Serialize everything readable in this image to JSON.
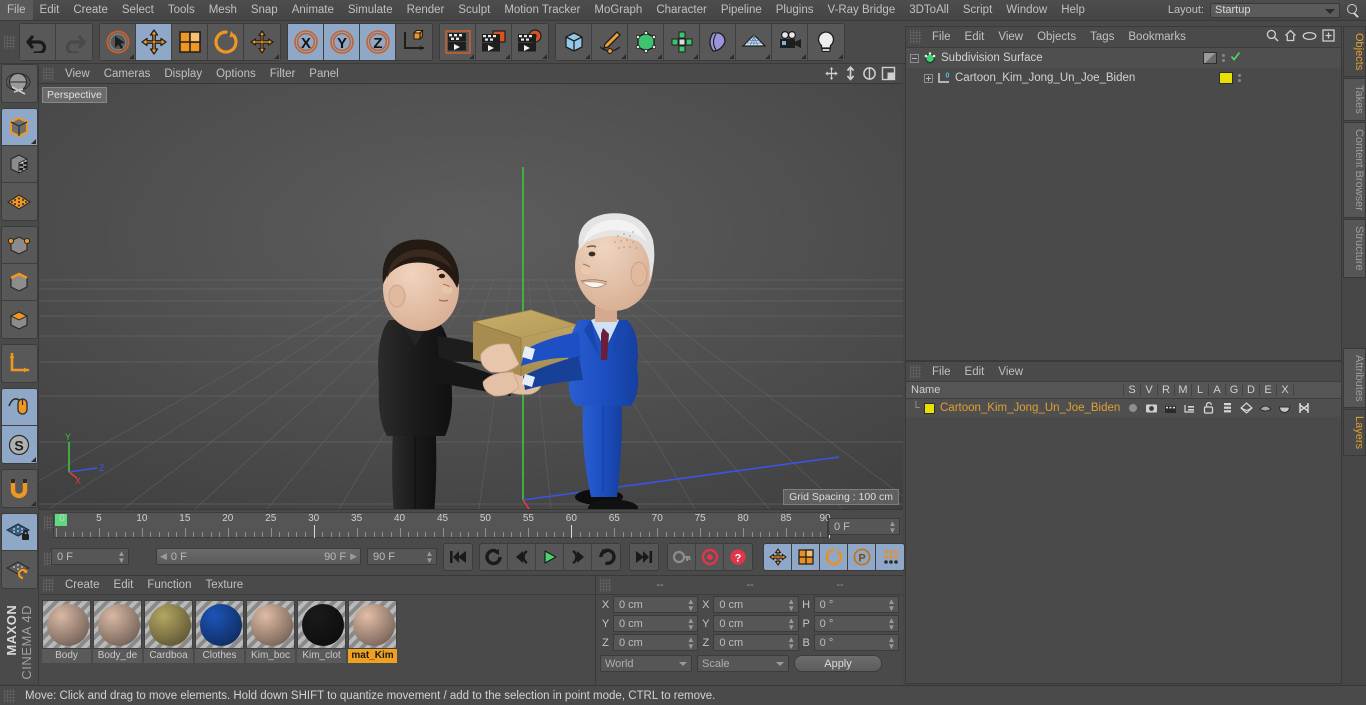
{
  "menubar": {
    "items": [
      "File",
      "Edit",
      "Create",
      "Select",
      "Tools",
      "Mesh",
      "Snap",
      "Animate",
      "Simulate",
      "Render",
      "Sculpt",
      "Motion Tracker",
      "MoGraph",
      "Character",
      "Pipeline",
      "Plugins",
      "V-Ray Bridge",
      "3DToAll",
      "Script",
      "Window",
      "Help"
    ],
    "layout_label": "Layout:",
    "layout_value": "Startup",
    "search_icon": "search-icon"
  },
  "toolbar": {
    "undo": "undo-arrow-icon",
    "redo": "redo-arrow-icon",
    "groups": [
      {
        "name": "selection-tools",
        "buttons": [
          {
            "icon": "live-selection-icon",
            "label": "Live Selection",
            "active": false
          },
          {
            "icon": "move-icon",
            "label": "Move",
            "active": true
          },
          {
            "icon": "scale-icon",
            "label": "Scale",
            "active": false
          },
          {
            "icon": "rotate-icon",
            "label": "Rotate",
            "active": false
          },
          {
            "icon": "move-alt-icon",
            "label": "Move Tool",
            "active": false
          }
        ]
      },
      {
        "name": "axis-locks",
        "buttons": [
          {
            "icon": "x-axis-icon",
            "label": "X",
            "active": true
          },
          {
            "icon": "y-axis-icon",
            "label": "Y",
            "active": true
          },
          {
            "icon": "z-axis-icon",
            "label": "Z",
            "active": true
          },
          {
            "icon": "world-object-axis-icon",
            "label": "World/Object",
            "active": false
          }
        ]
      },
      {
        "name": "render-tools",
        "buttons": [
          {
            "icon": "render-view-icon",
            "label": "Render View",
            "active": false
          },
          {
            "icon": "render-region-icon",
            "label": "Render to Picture Viewer",
            "active": false
          },
          {
            "icon": "render-settings-icon",
            "label": "Edit Render Settings",
            "active": false
          }
        ]
      },
      {
        "name": "object-creation",
        "buttons": [
          {
            "icon": "cube-primitive-icon",
            "label": "Cube",
            "active": false
          },
          {
            "icon": "spline-pen-icon",
            "label": "Pen",
            "active": false
          },
          {
            "icon": "nurbs-icon",
            "label": "Subdivision Surface",
            "active": false
          },
          {
            "icon": "array-icon",
            "label": "Array",
            "active": false
          },
          {
            "icon": "deformer-icon",
            "label": "Bend",
            "active": false
          },
          {
            "icon": "floor-environment-icon",
            "label": "Floor",
            "active": false
          },
          {
            "icon": "camera-icon",
            "label": "Camera",
            "active": false
          },
          {
            "icon": "light-icon",
            "label": "Light",
            "active": false
          }
        ]
      }
    ]
  },
  "left_toolbar": {
    "buttons": [
      {
        "icon": "make-editable-icon",
        "label": "Make Editable",
        "active": false
      },
      {
        "icon": "model-mode-icon",
        "label": "Model Mode",
        "active": true
      },
      {
        "icon": "texture-mode-icon",
        "label": "Texture Mode",
        "active": false
      },
      {
        "icon": "points-grid-icon",
        "label": "Points Mode",
        "active": false
      },
      {
        "icon": "point-mode-icon",
        "label": "Point Mode",
        "active": false
      },
      {
        "icon": "edge-mode-icon",
        "label": "Edge Mode",
        "active": false
      },
      {
        "icon": "polygon-mode-icon",
        "label": "Polygon Mode",
        "active": false
      },
      {
        "icon": "axis-modify-icon",
        "label": "Enable Axis Modification",
        "active": false
      },
      {
        "icon": "viewport-solo-icon",
        "label": "Viewport Solo",
        "active": true
      },
      {
        "icon": "snap-s-icon",
        "label": "Enable Snapping",
        "active": true
      },
      {
        "icon": "magnet-icon",
        "label": "Magnet",
        "active": false
      },
      {
        "icon": "workplane-lock-icon",
        "label": "Lock Workplane",
        "active": true
      },
      {
        "icon": "workplane-rotate-icon",
        "label": "Planar Workplane",
        "active": false
      }
    ],
    "brand_top": "MAXON",
    "brand_bottom": "CINEMA 4D"
  },
  "viewport": {
    "menu": [
      "View",
      "Cameras",
      "Display",
      "Options",
      "Filter",
      "Panel"
    ],
    "corner_icons": [
      "pan-view-icon",
      "zoom-view-icon",
      "rotate-view-icon",
      "maximize-view-icon"
    ],
    "label": "Perspective",
    "grid_spacing": "Grid Spacing : 100 cm",
    "axis_labels": {
      "x": "X",
      "y": "Y",
      "z": "Z"
    },
    "scene_description": "Two cartoon characters exchanging a cardboard box on a grid floor"
  },
  "timeline": {
    "tick_labels": [
      "0",
      "5",
      "10",
      "15",
      "20",
      "25",
      "30",
      "35",
      "40",
      "45",
      "50",
      "55",
      "60",
      "65",
      "70",
      "75",
      "80",
      "85",
      "90"
    ],
    "frame_min": 0,
    "frame_max": 90,
    "current_frame": "0 F",
    "range_start": "0 F",
    "range_end": "90 F",
    "end_field": "90 F",
    "right_frame_field": "0 F",
    "transport": [
      {
        "icon": "goto-start-icon",
        "label": "Go to Start",
        "active": false
      },
      {
        "icon": "step-back-key-icon",
        "label": "Go to Previous Key",
        "active": false
      },
      {
        "icon": "step-back-frame-icon",
        "label": "Go to Previous Frame",
        "active": false
      },
      {
        "icon": "play-icon",
        "label": "Play Forwards",
        "active": false
      },
      {
        "icon": "step-forward-frame-icon",
        "label": "Go to Next Frame",
        "active": false
      },
      {
        "icon": "step-forward-key-icon",
        "label": "Go to Next Key",
        "active": false
      },
      {
        "icon": "goto-end-icon",
        "label": "Go to End",
        "active": false
      }
    ],
    "record_tools": [
      {
        "icon": "autokey-key-icon",
        "label": "Autokeying",
        "active": false
      },
      {
        "icon": "record-active-icon",
        "label": "Record Active Objects",
        "active": false
      },
      {
        "icon": "record-question-icon",
        "label": "Keyframe Selection",
        "active": false
      }
    ],
    "key_toggles": [
      {
        "icon": "position-key-icon",
        "label": "Position",
        "active": true
      },
      {
        "icon": "scale-key-icon",
        "label": "Scale",
        "active": true
      },
      {
        "icon": "rotation-key-icon",
        "label": "Rotation",
        "active": true
      },
      {
        "icon": "parameter-key-icon",
        "label": "Parameter",
        "active": true
      },
      {
        "icon": "point-level-anim-icon",
        "label": "Point Level Animation",
        "active": true
      },
      {
        "icon": "film-strip-icon",
        "label": "Animation Mode",
        "active": true
      }
    ]
  },
  "material_manager": {
    "menu": [
      "Create",
      "Edit",
      "Function",
      "Texture"
    ],
    "materials": [
      {
        "name": "Body",
        "color": "#d9b8a4",
        "selected": false
      },
      {
        "name": "Body_de",
        "color": "#d9b8a4",
        "selected": false
      },
      {
        "name": "Cardboa",
        "color": "#b5a662",
        "selected": false
      },
      {
        "name": "Clothes",
        "color": "#1d54b8",
        "selected": false
      },
      {
        "name": "Kim_boc",
        "color": "#e0bba5",
        "selected": false
      },
      {
        "name": "Kim_clot",
        "color": "#1a1a1a",
        "selected": false
      },
      {
        "name": "mat_Kim",
        "color": "#e3bda7",
        "selected": true
      }
    ]
  },
  "coordinates": {
    "headers": [
      "--",
      "--",
      "--"
    ],
    "rows": [
      {
        "pos_label": "X",
        "pos_value": "0 cm",
        "size_label": "X",
        "size_value": "0 cm",
        "rot_label": "H",
        "rot_value": "0 °"
      },
      {
        "pos_label": "Y",
        "pos_value": "0 cm",
        "size_label": "Y",
        "size_value": "0 cm",
        "rot_label": "P",
        "rot_value": "0 °"
      },
      {
        "pos_label": "Z",
        "pos_value": "0 cm",
        "size_label": "Z",
        "size_value": "0 cm",
        "rot_label": "B",
        "rot_value": "0 °"
      }
    ],
    "system": "World",
    "mode": "Scale",
    "apply": "Apply"
  },
  "object_manager": {
    "menu": [
      "File",
      "Edit",
      "View",
      "Objects",
      "Tags",
      "Bookmarks"
    ],
    "header_icons": [
      "search-icon",
      "home-icon",
      "eye-icon",
      "new-layout-icon"
    ],
    "rows": [
      {
        "label": "Subdivision Surface",
        "icon": "subdivision-surface-icon",
        "indent": 0,
        "expander": "minus",
        "tag_swatch": "#8c8c8c",
        "check": true
      },
      {
        "label": "Cartoon_Kim_Jong_Un_Joe_Biden",
        "icon": "layer-zero-icon",
        "indent": 1,
        "expander": "plus",
        "tag_swatch": "#e8e000",
        "check": false
      }
    ]
  },
  "layer_manager": {
    "menu": [
      "File",
      "Edit",
      "View"
    ],
    "columns": [
      "Name",
      "S",
      "V",
      "R",
      "M",
      "L",
      "A",
      "G",
      "D",
      "E",
      "X"
    ],
    "rows": [
      {
        "name": "Cartoon_Kim_Jong_Un_Joe_Biden",
        "color": "#e8e000",
        "icons": [
          "solo-dot-icon",
          "visible-eye-icon",
          "render-clapper-icon",
          "manager-icon",
          "unlocked-padlock-icon",
          "animation-bars-icon",
          "generator-icon",
          "deformer-icon",
          "expression-icon",
          "xref-icon"
        ]
      }
    ]
  },
  "right_tabs": {
    "top": [
      {
        "label": "Objects",
        "active": true
      },
      {
        "label": "Takes",
        "active": false
      },
      {
        "label": "Content Browser",
        "active": false
      },
      {
        "label": "Structure",
        "active": false
      }
    ],
    "bottom": [
      {
        "label": "Attributes",
        "active": false
      },
      {
        "label": "Layers",
        "active": true
      }
    ]
  },
  "statusbar": {
    "text": "Move: Click and drag to move elements. Hold down SHIFT to quantize movement / add to the selection in point mode, CTRL to remove."
  }
}
